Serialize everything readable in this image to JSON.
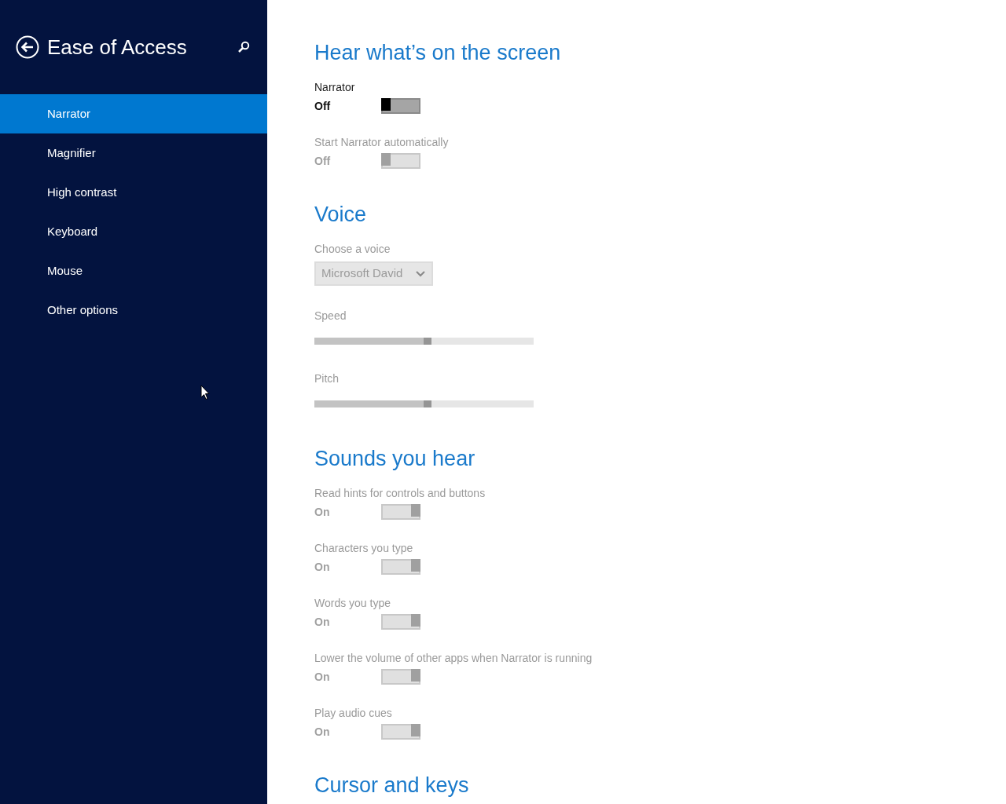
{
  "sidebar": {
    "title": "Ease of Access",
    "items": [
      {
        "label": "Narrator",
        "selected": true
      },
      {
        "label": "Magnifier",
        "selected": false
      },
      {
        "label": "High contrast",
        "selected": false
      },
      {
        "label": "Keyboard",
        "selected": false
      },
      {
        "label": "Mouse",
        "selected": false
      },
      {
        "label": "Other options",
        "selected": false
      }
    ]
  },
  "sections": [
    {
      "heading": "Hear what’s on the screen",
      "items": [
        {
          "kind": "toggle",
          "label": "Narrator",
          "state": "Off",
          "on": false,
          "disabled": false
        },
        {
          "kind": "toggle",
          "label": "Start Narrator automatically",
          "state": "Off",
          "on": false,
          "disabled": true
        }
      ]
    },
    {
      "heading": "Voice",
      "items": [
        {
          "kind": "dropdown",
          "label": "Choose a voice",
          "value": "Microsoft David",
          "disabled": true
        },
        {
          "kind": "slider",
          "label": "Speed",
          "level": 0.5,
          "disabled": true
        },
        {
          "kind": "slider",
          "label": "Pitch",
          "level": 0.5,
          "disabled": true
        }
      ]
    },
    {
      "heading": "Sounds you hear",
      "items": [
        {
          "kind": "toggle",
          "label": "Read hints for controls and buttons",
          "state": "On",
          "on": true,
          "disabled": true
        },
        {
          "kind": "toggle",
          "label": "Characters you type",
          "state": "On",
          "on": true,
          "disabled": true
        },
        {
          "kind": "toggle",
          "label": "Words you type",
          "state": "On",
          "on": true,
          "disabled": true
        },
        {
          "kind": "toggle",
          "label": "Lower the volume of other apps when Narrator is running",
          "state": "On",
          "on": true,
          "disabled": true
        },
        {
          "kind": "toggle",
          "label": "Play audio cues",
          "state": "On",
          "on": true,
          "disabled": true
        }
      ]
    },
    {
      "heading": "Cursor and keys"
    }
  ]
}
